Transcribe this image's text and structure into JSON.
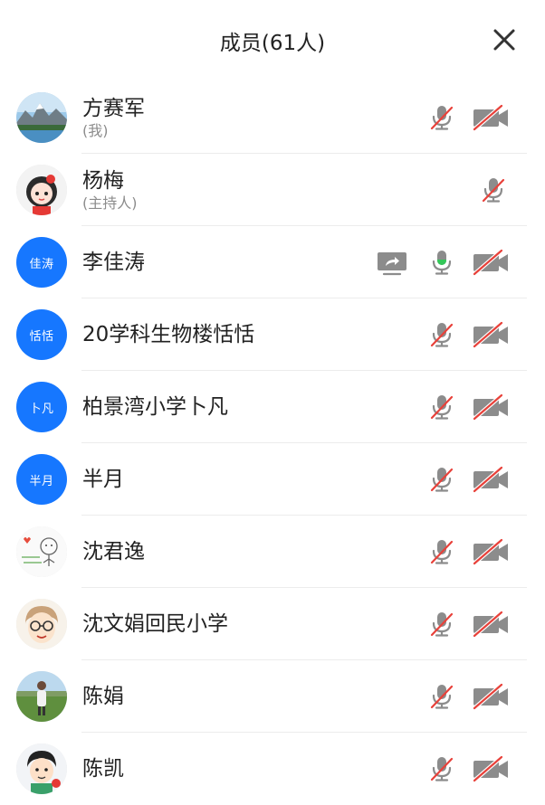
{
  "header": {
    "title": "成员(61人)",
    "close_icon": "close-icon"
  },
  "colors": {
    "accent": "#1677ff",
    "icon_gray": "#8c8c8c",
    "muted_red": "#e8413a",
    "active_green": "#34c759"
  },
  "members": [
    {
      "name": "方赛军",
      "role": "(我)",
      "avatar": "landscape-photo",
      "mic": "muted",
      "camera": "off"
    },
    {
      "name": "杨梅",
      "role": "(主持人)",
      "avatar": "cartoon-girl",
      "mic": "muted",
      "camera": "none"
    },
    {
      "name": "李佳涛",
      "avatar_text": "佳涛",
      "mic": "active",
      "camera": "off",
      "sharing": true
    },
    {
      "name": "20学科生物楼恬恬",
      "avatar_text": "恬恬",
      "mic": "muted",
      "camera": "off"
    },
    {
      "name": "柏景湾小学卜凡",
      "avatar_text": "卜凡",
      "mic": "muted",
      "camera": "off"
    },
    {
      "name": "半月",
      "avatar_text": "半月",
      "mic": "muted",
      "camera": "off"
    },
    {
      "name": "沈君逸",
      "avatar": "sketch-cartoon",
      "mic": "muted",
      "camera": "off"
    },
    {
      "name": "沈文娟回民小学",
      "avatar": "glasses-face",
      "mic": "muted",
      "camera": "off"
    },
    {
      "name": "陈娟",
      "avatar": "meadow-photo",
      "mic": "muted",
      "camera": "off"
    },
    {
      "name": "陈凯",
      "avatar": "boy-cartoon",
      "mic": "muted",
      "camera": "off"
    }
  ]
}
